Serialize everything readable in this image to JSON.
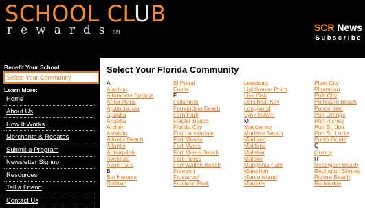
{
  "logo": {
    "top_orange": "SCHOOL CL",
    "top_white": "U",
    "top_orange2": "B",
    "bottom": "rewards",
    "tm": "SM"
  },
  "news": {
    "prefix": "SCR",
    "title": " News",
    "subtitle": "Subscribe"
  },
  "sidebar": {
    "benefit_heading": "Benefit Your School",
    "selected": "Select Your Community",
    "learn_heading": "Learn More:",
    "items": [
      "Home",
      "About Us",
      "How It Works",
      "Merchants & Rebates",
      "Submit a Program",
      "Newsletter Signup",
      "Resources",
      "Tell a Friend",
      "Contact Us"
    ]
  },
  "main": {
    "title": "Select Your Florida Community",
    "columns": [
      [
        {
          "t": "A",
          "h": true
        },
        {
          "t": "Alachua"
        },
        {
          "t": "Altamonte Springs"
        },
        {
          "t": "Anna Maria"
        },
        {
          "t": "Apalachicola"
        },
        {
          "t": "Apopka"
        },
        {
          "t": "Arcadia"
        },
        {
          "t": "Archer"
        },
        {
          "t": "Astatula"
        },
        {
          "t": "Atlantic Beach"
        },
        {
          "t": "Atlantis"
        },
        {
          "t": "Auburndale"
        },
        {
          "t": "Aventura"
        },
        {
          "t": "Avon Park"
        },
        {
          "t": "B",
          "h": true
        },
        {
          "t": "Bal Harbour"
        },
        {
          "t": "Baldwin"
        }
      ],
      [
        {
          "t": "El Portal"
        },
        {
          "t": "Eustis"
        },
        {
          "t": "F",
          "h": true
        },
        {
          "t": "Fellsmere"
        },
        {
          "t": "Fernandina Beach"
        },
        {
          "t": "Fern Park"
        },
        {
          "t": "Flagler Beach"
        },
        {
          "t": "Florida City"
        },
        {
          "t": "Fort Lauderdale"
        },
        {
          "t": "Fort Meade"
        },
        {
          "t": "Fort Myers"
        },
        {
          "t": "Fort Myers Beach"
        },
        {
          "t": "Fort Pierce"
        },
        {
          "t": "Fort Walton Beach"
        },
        {
          "t": "Freeport"
        },
        {
          "t": "Frostproof"
        },
        {
          "t": "Fruitland Park"
        }
      ],
      [
        {
          "t": "Leesburg"
        },
        {
          "t": "Lighthouse Point"
        },
        {
          "t": "Live Oak"
        },
        {
          "t": "Longboat Key"
        },
        {
          "t": "Longwood"
        },
        {
          "t": "Lynn Haven"
        },
        {
          "t": "M",
          "h": true
        },
        {
          "t": "Macclenny"
        },
        {
          "t": "Madeira Beach"
        },
        {
          "t": "Madison"
        },
        {
          "t": "Maitland"
        },
        {
          "t": "Malabar"
        },
        {
          "t": "Malone"
        },
        {
          "t": "Mangonia Park"
        },
        {
          "t": "Marathon"
        },
        {
          "t": "Marco Island"
        },
        {
          "t": "Margate"
        }
      ],
      [
        {
          "t": "Plant City"
        },
        {
          "t": "Plantation"
        },
        {
          "t": "Polk City"
        },
        {
          "t": "Pompano Beach"
        },
        {
          "t": "Ponce Inlet"
        },
        {
          "t": "Port Orange"
        },
        {
          "t": "Port Richey"
        },
        {
          "t": "Port St. Joe"
        },
        {
          "t": "Port St. Lucie"
        },
        {
          "t": "Punta Gorda"
        },
        {
          "t": "Q",
          "h": true
        },
        {
          "t": "Quincy"
        },
        {
          "t": "R",
          "h": true
        },
        {
          "t": "Redington Beach"
        },
        {
          "t": "Redington Shores"
        },
        {
          "t": "Riviera Beach"
        },
        {
          "t": "Rockledge"
        }
      ]
    ]
  },
  "colors": {
    "accent": "#e47a22",
    "background": "#000000"
  }
}
